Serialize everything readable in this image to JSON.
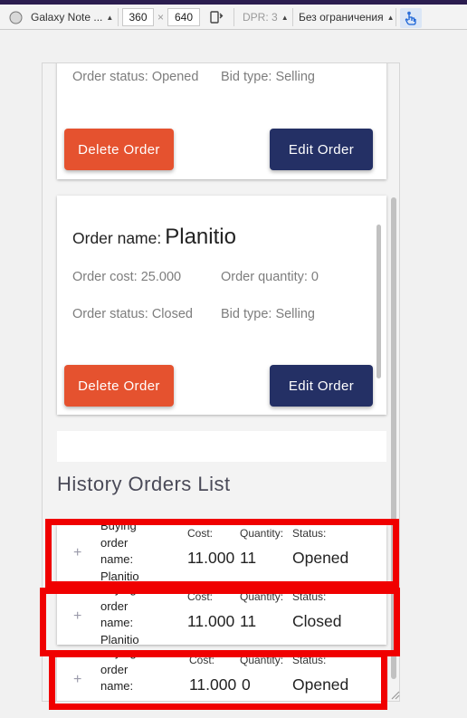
{
  "devtools": {
    "device": "Galaxy Note ...",
    "width": "360",
    "times": "×",
    "height": "640",
    "dpr": "DPR: 3",
    "throttle": "Без ограничения"
  },
  "orders": [
    {
      "status": "Order status: Opened",
      "bid": "Bid type: Selling",
      "delete_label": "Delete Order",
      "edit_label": "Edit Order"
    },
    {
      "title_label": "Order name:",
      "title_value": "Planitio",
      "cost": "Order cost: 25.000",
      "quantity": "Order quantity: 0",
      "status": "Order status: Closed",
      "bid": "Bid type: Selling",
      "delete_label": "Delete Order",
      "edit_label": "Edit Order"
    }
  ],
  "history": {
    "title": "History Orders List",
    "items": [
      {
        "plus": "+",
        "name_lines": [
          "Buying",
          "order",
          "name:",
          "Planitio"
        ],
        "cost_label": "Cost:",
        "cost": "11.000",
        "qty_label": "Quantity:",
        "qty": "11",
        "status_label": "Status:",
        "status": "Opened"
      },
      {
        "plus": "+",
        "name_lines": [
          "Buying",
          "order",
          "name:",
          "Planitio"
        ],
        "cost_label": "Cost:",
        "cost": "11.000",
        "qty_label": "Quantity:",
        "qty": "11",
        "status_label": "Status:",
        "status": "Closed"
      },
      {
        "plus": "+",
        "name_lines": [
          "Buying",
          "order",
          "name:"
        ],
        "cost_label": "Cost:",
        "cost": "11.000",
        "qty_label": "Quantity:",
        "qty": "0",
        "status_label": "Status:",
        "status": "Opened"
      }
    ]
  },
  "colors": {
    "delete": "#e5522f",
    "edit": "#243065",
    "highlight": "#f00000"
  }
}
